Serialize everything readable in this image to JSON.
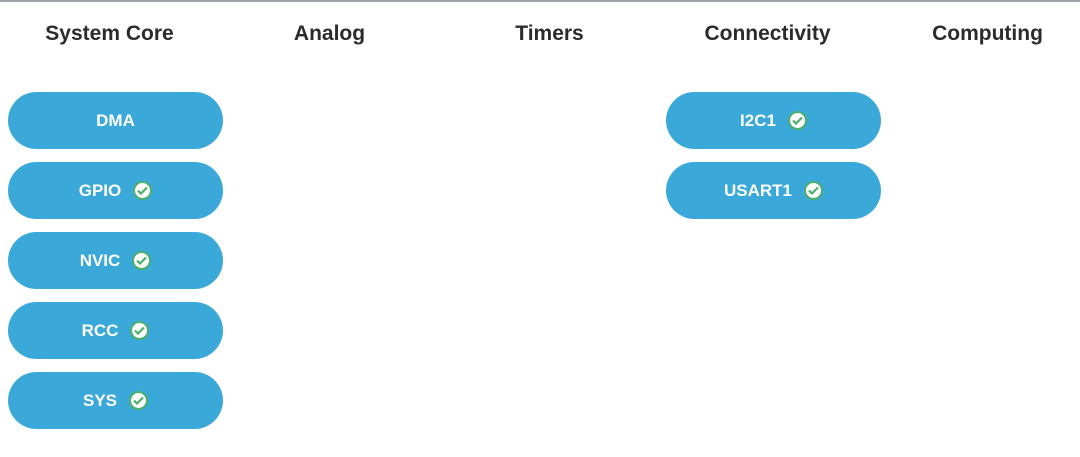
{
  "categories": [
    {
      "title": "System Core",
      "items": [
        {
          "label": "DMA",
          "configured": false
        },
        {
          "label": "GPIO",
          "configured": true
        },
        {
          "label": "NVIC",
          "configured": true
        },
        {
          "label": "RCC",
          "configured": true
        },
        {
          "label": "SYS",
          "configured": true
        }
      ]
    },
    {
      "title": "Analog",
      "items": []
    },
    {
      "title": "Timers",
      "items": []
    },
    {
      "title": "Connectivity",
      "items": [
        {
          "label": "I2C1",
          "configured": true
        },
        {
          "label": "USART1",
          "configured": true
        }
      ]
    },
    {
      "title": "Computing",
      "items": []
    }
  ],
  "colors": {
    "button": "#3aa8d8",
    "check": "#4caf6e"
  }
}
